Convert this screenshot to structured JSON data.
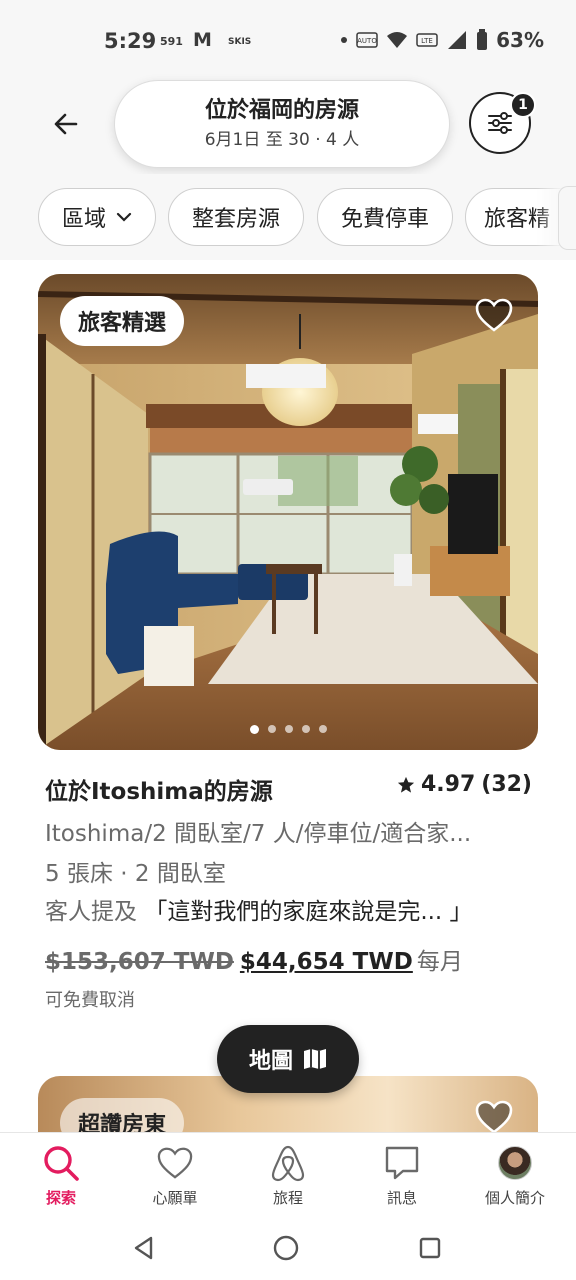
{
  "status_bar": {
    "time": "5:29",
    "notif_1": "591",
    "notif_2": "M",
    "notif_3": "SKIS",
    "battery": "63%"
  },
  "header": {
    "title": "位於福岡的房源",
    "subtitle": "6月1日 至 30 · 4 人",
    "filter_badge": "1"
  },
  "chips": [
    {
      "label": "區域"
    },
    {
      "label": "整套房源"
    },
    {
      "label": "免費停車"
    },
    {
      "label": "旅客精"
    }
  ],
  "listing": {
    "badge": "旅客精選",
    "title": "位於Itoshima的房源",
    "rating": "4.97",
    "review_count": "(32)",
    "description": "Itoshima/2 間臥室/7 人/停車位/適合家...",
    "beds": "5 張床 · 2 間臥室",
    "quote_prefix": "客人提及",
    "quote": "「這對我們的家庭來說是完... 」",
    "price_old": "$153,607 TWD",
    "price_new": "$44,654 TWD",
    "price_unit": "每月",
    "cancel_note": "可免費取消",
    "photo_count": 5,
    "active_photo": 0
  },
  "map_button": {
    "label": "地圖"
  },
  "next_listing": {
    "badge": "超讚房東"
  },
  "bottom_nav": [
    {
      "label": "探索",
      "icon": "search-icon",
      "active": true
    },
    {
      "label": "心願單",
      "icon": "heart-icon",
      "active": false
    },
    {
      "label": "旅程",
      "icon": "airbnb-logo-icon",
      "active": false
    },
    {
      "label": "訊息",
      "icon": "message-icon",
      "active": false
    },
    {
      "label": "個人簡介",
      "icon": "avatar",
      "active": false
    }
  ],
  "colors": {
    "accent": "#e31c5f",
    "text": "#222222",
    "muted": "#6a6a6a"
  }
}
